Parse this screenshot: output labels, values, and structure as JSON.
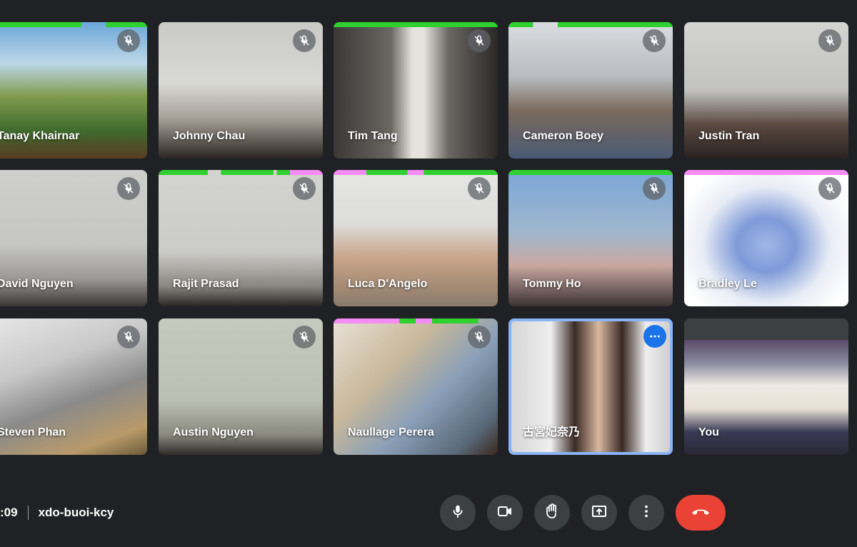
{
  "meeting": {
    "time": ":09",
    "code": "xdo-buoi-kcy"
  },
  "participants": [
    {
      "name": "Tanay Khairnar",
      "muted": true
    },
    {
      "name": "Johnny Chau",
      "muted": true
    },
    {
      "name": "Tim Tang",
      "muted": true
    },
    {
      "name": "Cameron Boey",
      "muted": true
    },
    {
      "name": "Justin Tran",
      "muted": true
    },
    {
      "name": "David Nguyen",
      "muted": true
    },
    {
      "name": "Rajit Prasad",
      "muted": true
    },
    {
      "name": "Luca D'Angelo",
      "muted": true
    },
    {
      "name": "Tommy Ho",
      "muted": true
    },
    {
      "name": "Bradley Le",
      "muted": true
    },
    {
      "name": "Steven Phan",
      "muted": true
    },
    {
      "name": "Austin Nguyen",
      "muted": true
    },
    {
      "name": "Naullage Perera",
      "muted": true
    },
    {
      "name": "古宮妃奈乃",
      "muted": false
    },
    {
      "name": "You",
      "muted": false
    }
  ],
  "controls": [
    {
      "icon": "mic-icon"
    },
    {
      "icon": "camera-icon"
    },
    {
      "icon": "raise-hand-icon"
    },
    {
      "icon": "present-screen-icon"
    },
    {
      "icon": "more-options-icon"
    },
    {
      "icon": "end-call-icon"
    }
  ],
  "colors": {
    "background": "#202124",
    "tile": "#3c4043",
    "active_border": "#8ab4f8",
    "more_button": "#1a73e8",
    "end_call": "#ea4335",
    "speaking_green": "#2fd02f",
    "speaking_pink": "#f58cf5"
  }
}
